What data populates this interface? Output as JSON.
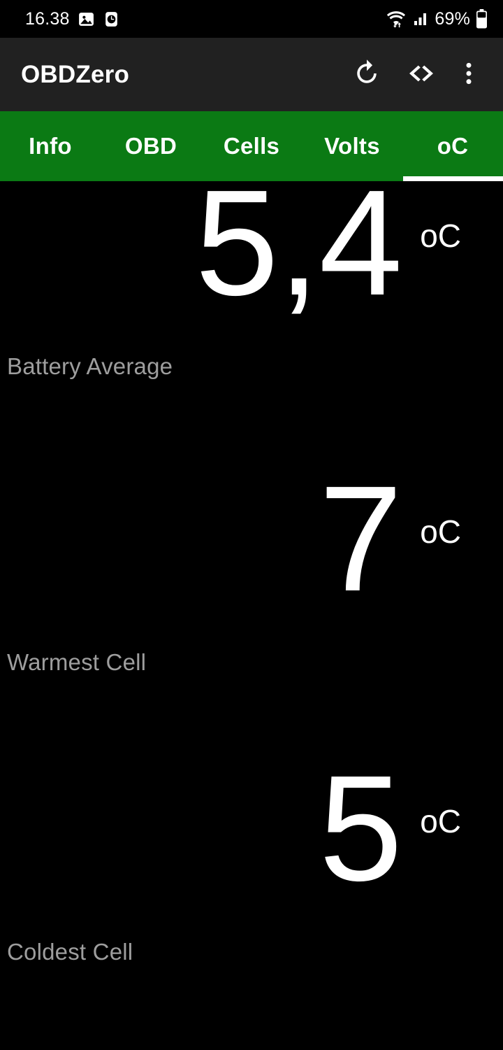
{
  "status_bar": {
    "time": "16.38",
    "left_icons": [
      "image-icon",
      "alarm-clock-icon"
    ],
    "right_icons": [
      "wifi-transfer-icon",
      "cellular-signal-icon"
    ],
    "battery_percent": "69%",
    "battery_icon": "battery-icon"
  },
  "app_bar": {
    "title": "OBDZero",
    "actions": [
      {
        "name": "refresh-button",
        "icon": "refresh-icon"
      },
      {
        "name": "code-button",
        "icon": "code-brackets-icon"
      },
      {
        "name": "overflow-menu-button",
        "icon": "more-vertical-icon"
      }
    ]
  },
  "tabs": {
    "items": [
      {
        "label": "Info"
      },
      {
        "label": "OBD"
      },
      {
        "label": "Cells"
      },
      {
        "label": "Volts"
      },
      {
        "label": "oC"
      }
    ],
    "active_index": 4
  },
  "readings": [
    {
      "value": "5,4",
      "unit": "oC",
      "label": "Battery Average"
    },
    {
      "value": "7",
      "unit": "oC",
      "label": "Warmest Cell"
    },
    {
      "value": "5",
      "unit": "oC",
      "label": "Coldest Cell"
    }
  ],
  "colors": {
    "accent_green": "#0B7A14",
    "app_bar": "#212121",
    "background": "#000000",
    "value_text": "#FFFFFF",
    "label_text": "#9E9E9E"
  }
}
